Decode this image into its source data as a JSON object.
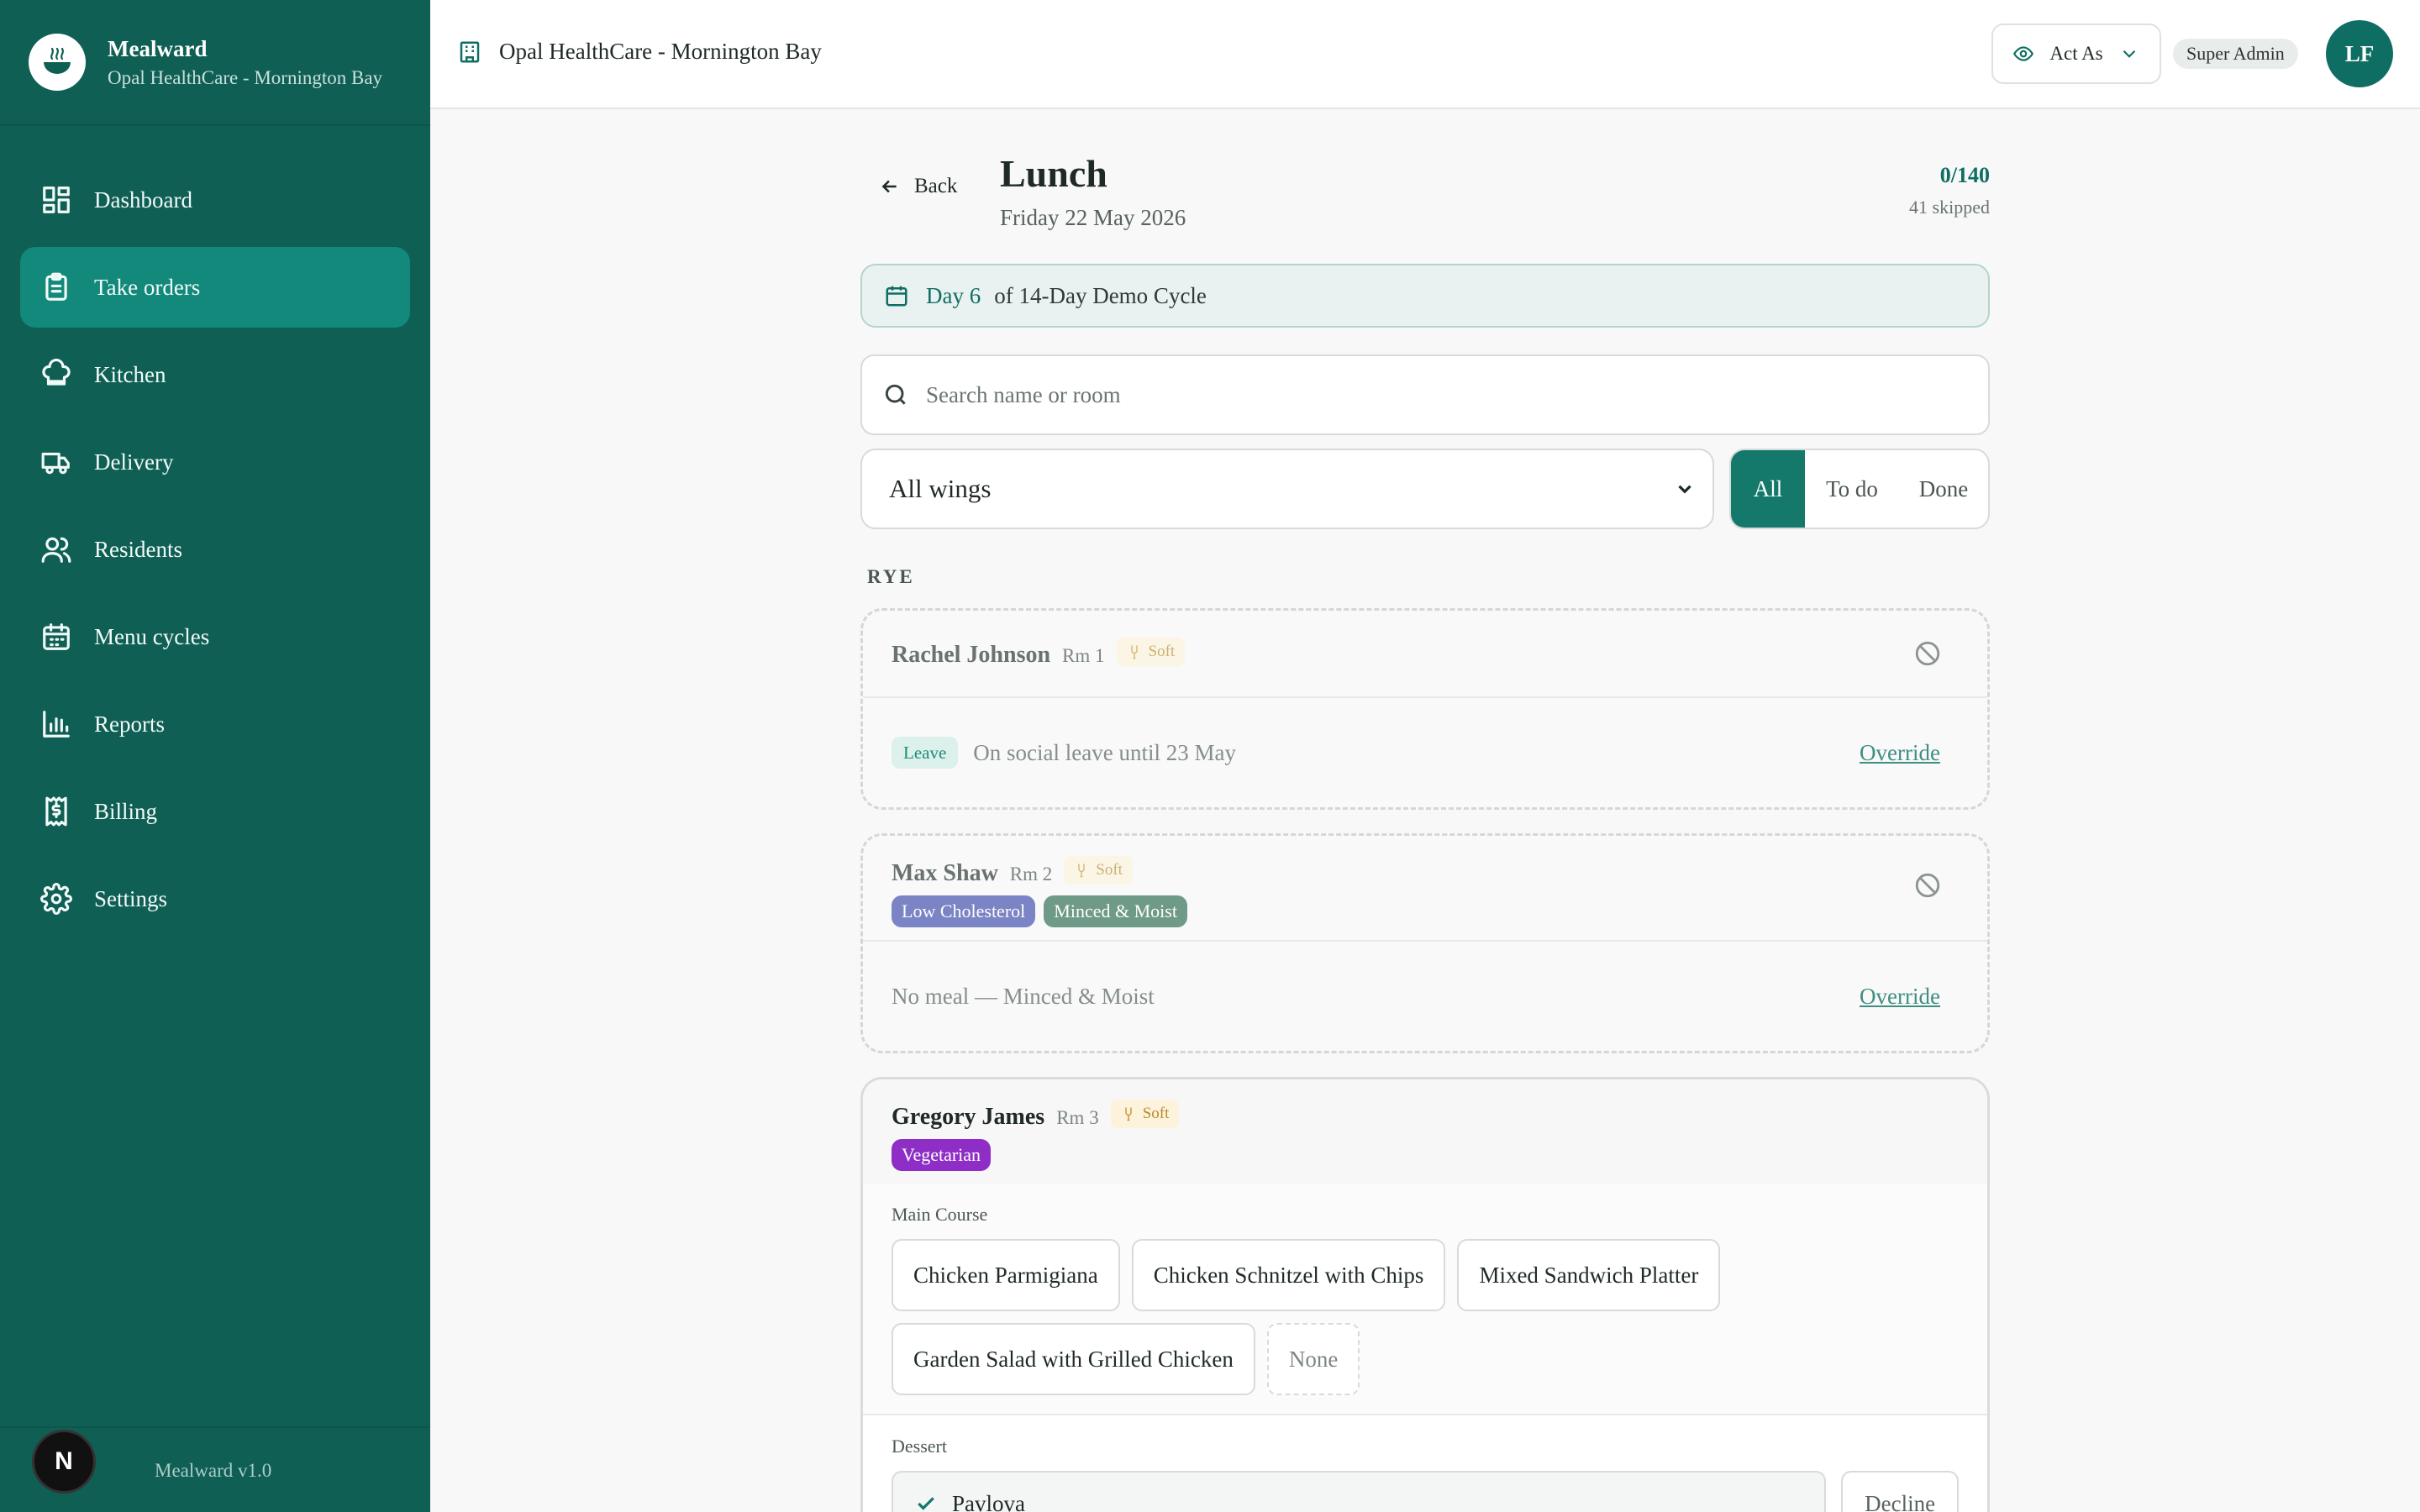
{
  "brand": {
    "name": "Mealward",
    "facility": "Opal HealthCare - Mornington Bay"
  },
  "nav": [
    {
      "label": "Dashboard",
      "icon": "grid-icon"
    },
    {
      "label": "Take orders",
      "icon": "clipboard-icon",
      "active": true
    },
    {
      "label": "Kitchen",
      "icon": "chef-hat-icon"
    },
    {
      "label": "Delivery",
      "icon": "truck-icon"
    },
    {
      "label": "Residents",
      "icon": "users-icon"
    },
    {
      "label": "Menu cycles",
      "icon": "calendar-icon"
    },
    {
      "label": "Reports",
      "icon": "bar-chart-icon"
    },
    {
      "label": "Billing",
      "icon": "receipt-icon"
    },
    {
      "label": "Settings",
      "icon": "gear-icon"
    }
  ],
  "footer": {
    "badge": "N",
    "version": "Mealward v1.0"
  },
  "topbar": {
    "facility": "Opal HealthCare - Mornington Bay",
    "act_as": "Act As",
    "role": "Super Admin",
    "avatar_initials": "LF"
  },
  "page": {
    "back": "Back",
    "title": "Lunch",
    "date": "Friday 22 May 2026",
    "progress": "0/140",
    "skipped": "41 skipped"
  },
  "cycle": {
    "day": "Day 6",
    "rest": "of 14-Day Demo Cycle"
  },
  "search": {
    "placeholder": "Search name or room"
  },
  "filters": {
    "wing": "All wings",
    "segments": [
      "All",
      "To do",
      "Done"
    ],
    "selected": "All"
  },
  "wing_group": "RYE",
  "residents": [
    {
      "name": "Rachel Johnson",
      "room": "Rm 1",
      "texture": "Soft",
      "status_badge": "Leave",
      "status_text": "On social leave until 23 May",
      "action": "Override"
    },
    {
      "name": "Max Shaw",
      "room": "Rm 2",
      "texture": "Soft",
      "tags": [
        "Low Cholesterol",
        "Minced & Moist"
      ],
      "status_text": "No meal — Minced & Moist",
      "action": "Override"
    },
    {
      "name": "Gregory James",
      "room": "Rm 3",
      "texture": "Soft",
      "tags": [
        "Vegetarian"
      ],
      "main_course_label": "Main Course",
      "main_course": [
        "Chicken Parmigiana",
        "Chicken Schnitzel with Chips",
        "Mixed Sandwich Platter",
        "Garden Salad with Grilled Chicken",
        "None"
      ],
      "dessert_label": "Dessert",
      "dessert_choice": "Pavlova",
      "dessert_decline": "Decline"
    }
  ],
  "colors": {
    "sidebar": "#0f5f55",
    "accent": "#14786b",
    "tag_low_cholesterol": "#7b84c4",
    "tag_minced": "#6f9a87",
    "tag_vegetarian": "#8e2ec6"
  }
}
